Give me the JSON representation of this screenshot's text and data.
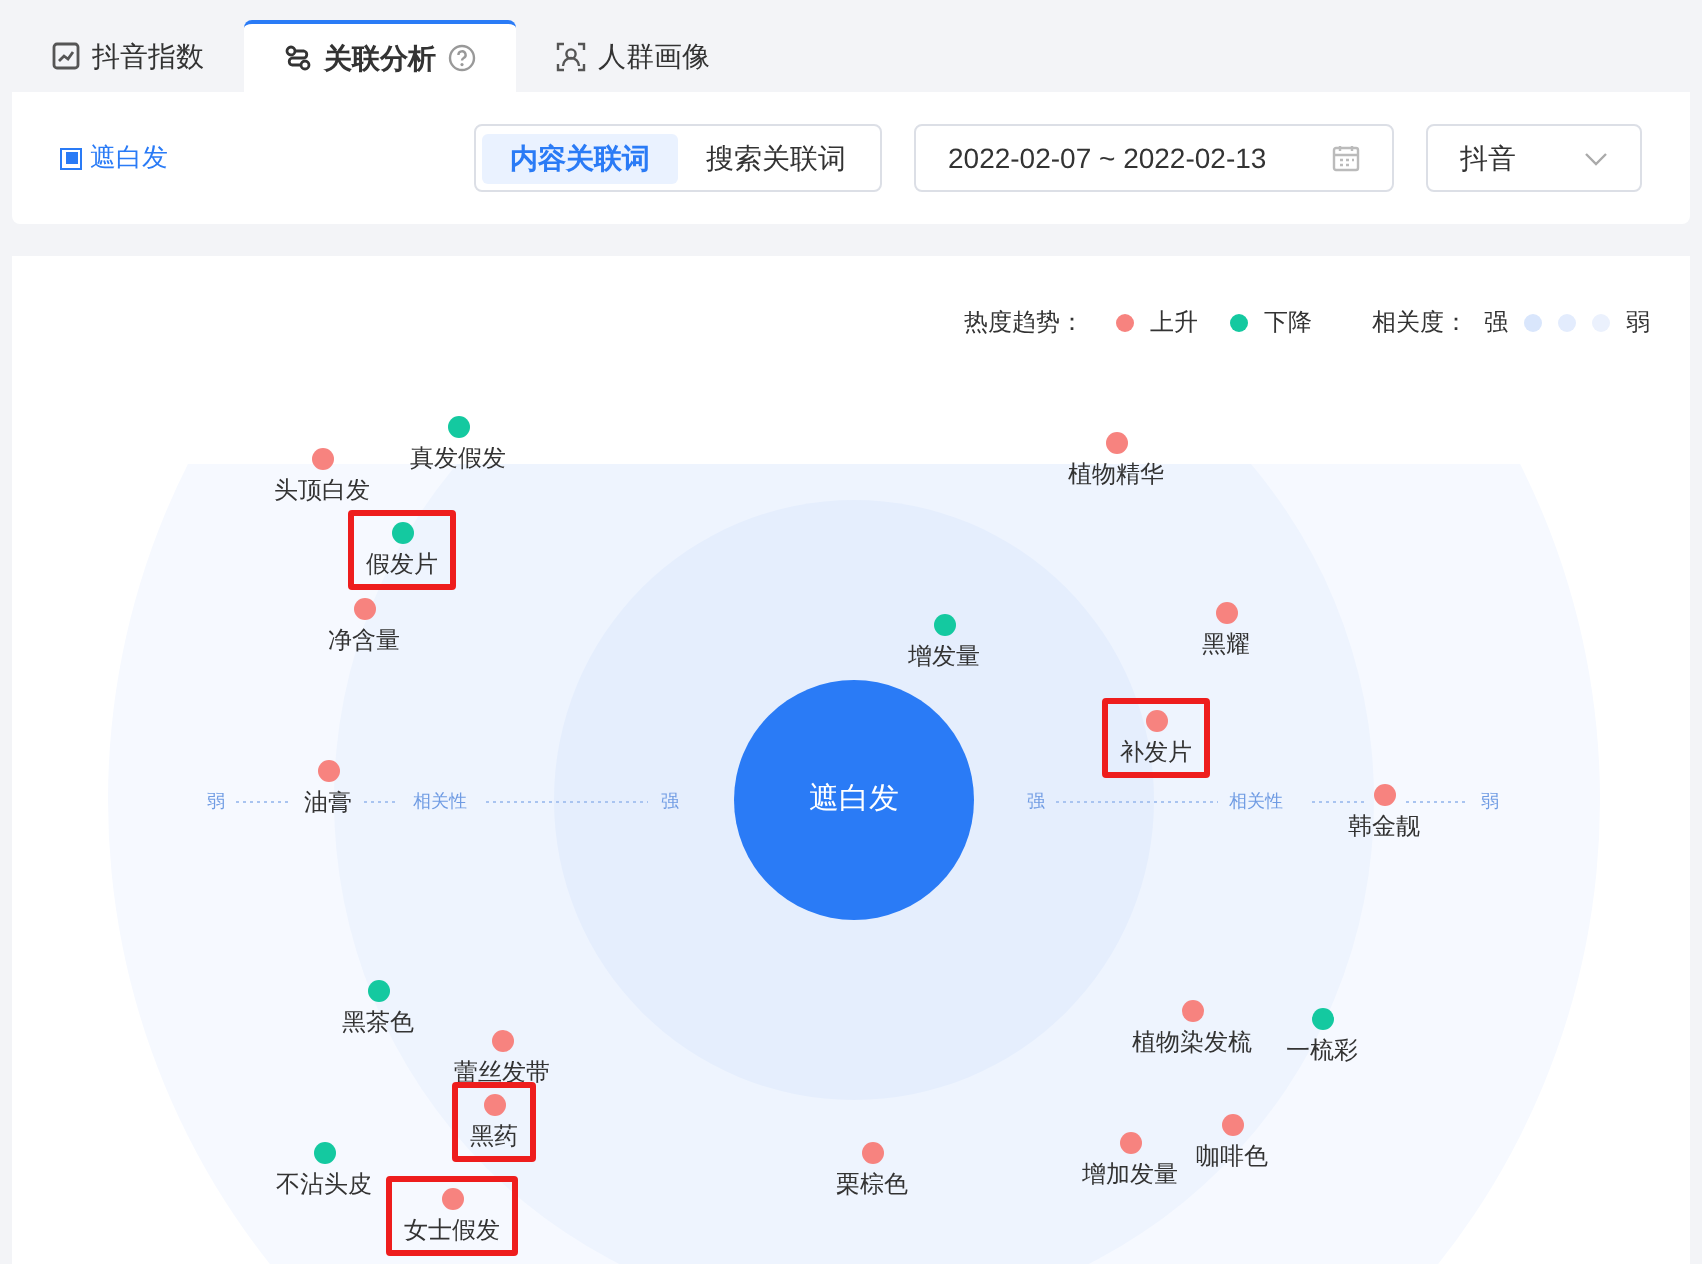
{
  "tabs": [
    {
      "label": "抖音指数",
      "selected": false
    },
    {
      "label": "关联分析",
      "selected": true
    },
    {
      "label": "人群画像",
      "selected": false
    }
  ],
  "keyword": {
    "label": "遮白发",
    "checked": true
  },
  "segments": [
    {
      "label": "内容关联词",
      "selected": true
    },
    {
      "label": "搜索关联词",
      "selected": false
    }
  ],
  "date_range": "2022-02-07 ~ 2022-02-13",
  "platform": "抖音",
  "legend": {
    "trend_title": "热度趋势：",
    "trends": [
      {
        "label": "上升",
        "color": "#f7837f"
      },
      {
        "label": "下降",
        "color": "#14c9a0"
      }
    ],
    "relevance_title": "相关度：",
    "strong": "强",
    "weak": "弱"
  },
  "graph": {
    "center": "遮白发",
    "axis_left": [
      "弱",
      "相关性",
      "强"
    ],
    "axis_right": [
      "强",
      "相关性",
      "弱"
    ],
    "nodes": [
      {
        "label": "头顶白发",
        "color": "#f7837f",
        "highlighted": false
      },
      {
        "label": "真发假发",
        "color": "#14c9a0",
        "highlighted": false
      },
      {
        "label": "假发片",
        "color": "#14c9a0",
        "highlighted": true
      },
      {
        "label": "净含量",
        "color": "#f7837f",
        "highlighted": false
      },
      {
        "label": "植物精华",
        "color": "#f7837f",
        "highlighted": false
      },
      {
        "label": "增发量",
        "color": "#14c9a0",
        "highlighted": false
      },
      {
        "label": "黑耀",
        "color": "#f7837f",
        "highlighted": false
      },
      {
        "label": "补发片",
        "color": "#f7837f",
        "highlighted": true
      },
      {
        "label": "油膏",
        "color": "#f7837f",
        "highlighted": false
      },
      {
        "label": "韩金靓",
        "color": "#f7837f",
        "highlighted": false
      },
      {
        "label": "黑茶色",
        "color": "#14c9a0",
        "highlighted": false
      },
      {
        "label": "植物染发梳",
        "color": "#f7837f",
        "highlighted": false
      },
      {
        "label": "一梳彩",
        "color": "#14c9a0",
        "highlighted": false
      },
      {
        "label": "蕾丝发带",
        "color": "#f7837f",
        "highlighted": false
      },
      {
        "label": "黑药",
        "color": "#f7837f",
        "highlighted": true
      },
      {
        "label": "不沾头皮",
        "color": "#14c9a0",
        "highlighted": false
      },
      {
        "label": "栗棕色",
        "color": "#f7837f",
        "highlighted": false
      },
      {
        "label": "增加发量",
        "color": "#f7837f",
        "highlighted": false
      },
      {
        "label": "咖啡色",
        "color": "#f7837f",
        "highlighted": false
      },
      {
        "label": "女士假发",
        "color": "#f7837f",
        "highlighted": true
      }
    ]
  }
}
